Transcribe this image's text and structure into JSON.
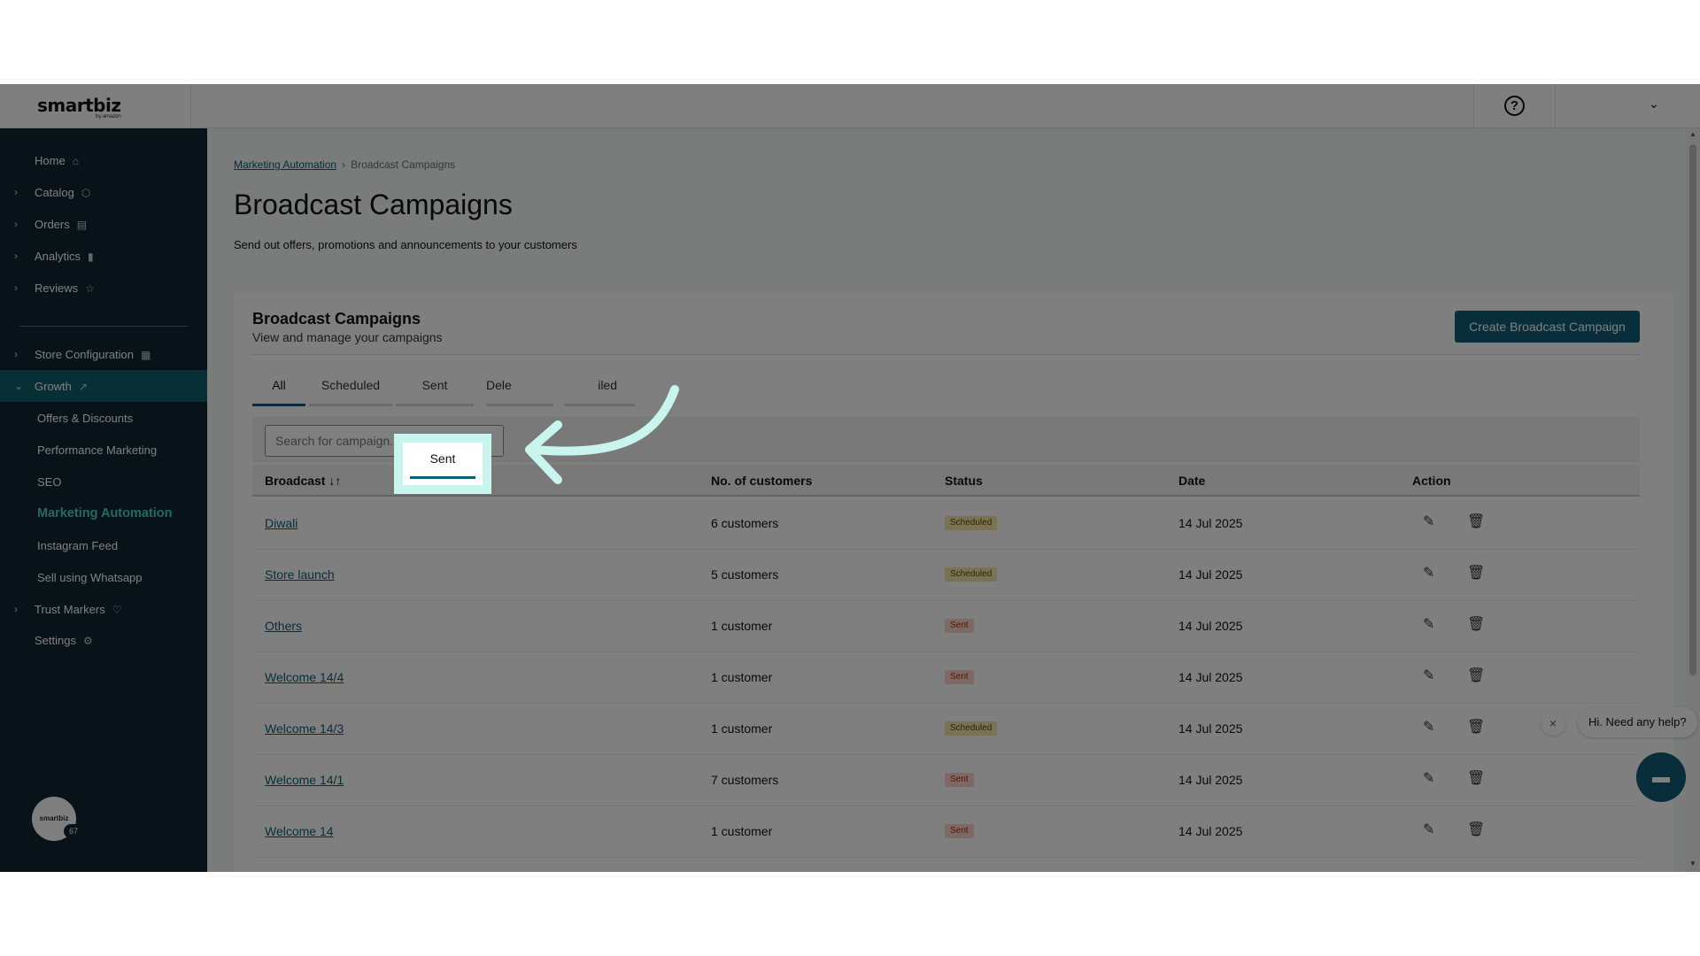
{
  "header": {
    "logo_text": "smartbiz",
    "logo_sub": "by amazon",
    "help_symbol": "?",
    "account_chevron": "⌄"
  },
  "sidebar": {
    "items": [
      {
        "label": "Home",
        "icon": "home-icon",
        "glyph": "⌂"
      },
      {
        "label": "Catalog",
        "icon": "box-icon",
        "glyph": "⬡"
      },
      {
        "label": "Orders",
        "icon": "clipboard-icon",
        "glyph": "▤"
      },
      {
        "label": "Analytics",
        "icon": "bar-chart-icon",
        "glyph": "▮"
      },
      {
        "label": "Reviews",
        "icon": "star-icon",
        "glyph": "☆"
      },
      {
        "label": "Store Configuration",
        "icon": "store-icon",
        "glyph": "▦"
      },
      {
        "label": "Growth",
        "icon": "trend-up-icon",
        "glyph": "↗"
      },
      {
        "label": "Trust Markers",
        "icon": "heart-shield-icon",
        "glyph": "♡"
      },
      {
        "label": "Settings",
        "icon": "gear-icon",
        "glyph": "⚙"
      }
    ],
    "growth_sub": [
      "Offers & Discounts",
      "Performance Marketing",
      "SEO",
      "Marketing Automation",
      "Instagram Feed",
      "Sell using Whatsapp"
    ],
    "avatar_text": "smartbiz",
    "avatar_badge": "67"
  },
  "breadcrumb": {
    "parent": "Marketing Automation",
    "separator": "›",
    "current": "Broadcast Campaigns"
  },
  "page": {
    "title": "Broadcast Campaigns",
    "subtitle": "Send out offers, promotions and announcements to your customers"
  },
  "card": {
    "title": "Broadcast Campaigns",
    "subtitle": "View and manage your campaigns",
    "create_button": "Create Broadcast Campaign"
  },
  "tabs": [
    "All",
    "Scheduled",
    "Sent",
    "Delivered",
    "Failed"
  ],
  "tabs_visible": {
    "delivered": "Dele",
    "failed": "iled"
  },
  "search": {
    "placeholder": "Search for campaign..."
  },
  "table": {
    "headers": {
      "broadcast": "Broadcast ↓↑",
      "customers": "No. of customers",
      "status": "Status",
      "date": "Date",
      "action": "Action"
    },
    "rows": [
      {
        "name": "Diwali",
        "customers": "6 customers",
        "status": "Scheduled",
        "date": "14 Jul 2025"
      },
      {
        "name": "Store launch",
        "customers": "5 customers",
        "status": "Scheduled",
        "date": "14 Jul 2025"
      },
      {
        "name": "Others",
        "customers": "1 customer",
        "status": "Sent",
        "date": "14 Jul 2025"
      },
      {
        "name": "Welcome 14/4",
        "customers": "1 customer",
        "status": "Sent",
        "date": "14 Jul 2025"
      },
      {
        "name": "Welcome 14/3",
        "customers": "1 customer",
        "status": "Scheduled",
        "date": "14 Jul 2025"
      },
      {
        "name": "Welcome 14/1",
        "customers": "7 customers",
        "status": "Sent",
        "date": "14 Jul 2025"
      },
      {
        "name": "Welcome 14",
        "customers": "1 customer",
        "status": "Sent",
        "date": "14 Jul 2025"
      }
    ]
  },
  "chat": {
    "close": "×",
    "message": "Hi. Need any help?",
    "icon": "chat-icon"
  },
  "colors": {
    "accent": "#0f5d74",
    "sidebar_bg": "#0e2732",
    "highlight": "#c9f5ee",
    "sent_badge": "#fbd3cc",
    "scheduled_badge": "#f5e7a6"
  }
}
